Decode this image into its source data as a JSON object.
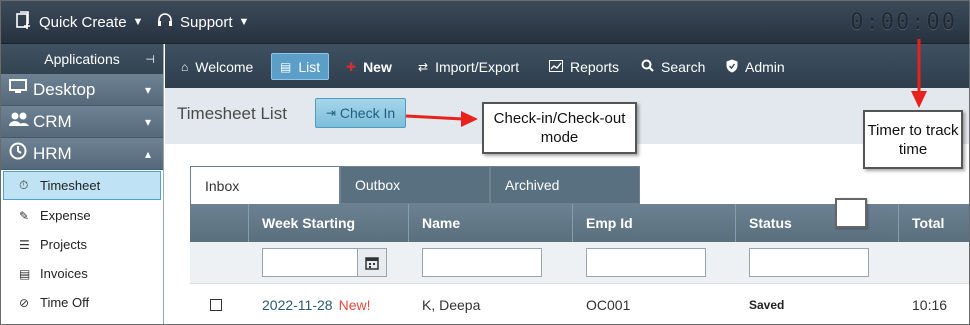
{
  "topbar": {
    "quick_create": "Quick Create",
    "support": "Support",
    "timer": "0:00:00"
  },
  "sidebar": {
    "header": "Applications",
    "modules": [
      {
        "label": "Desktop",
        "icon": "monitor-icon"
      },
      {
        "label": "CRM",
        "icon": "people-icon"
      },
      {
        "label": "HRM",
        "icon": "clock-icon"
      }
    ],
    "items": [
      {
        "label": "Timesheet",
        "icon": "stopwatch-icon"
      },
      {
        "label": "Expense",
        "icon": "money-icon"
      },
      {
        "label": "Projects",
        "icon": "list-icon"
      },
      {
        "label": "Invoices",
        "icon": "invoice-icon"
      },
      {
        "label": "Time Off",
        "icon": "time-off-icon"
      }
    ]
  },
  "nav": {
    "items": [
      {
        "label": "Welcome",
        "icon": "home-icon"
      },
      {
        "label": "List",
        "icon": "list-doc-icon"
      },
      {
        "label": "New",
        "icon": "new-icon"
      },
      {
        "label": "Import/Export",
        "icon": "swap-icon"
      },
      {
        "label": "Reports",
        "icon": "chart-icon"
      },
      {
        "label": "Search",
        "icon": "search-icon"
      },
      {
        "label": "Admin",
        "icon": "shield-icon"
      }
    ],
    "active": "List"
  },
  "content": {
    "title": "Timesheet List",
    "checkin_label": "Check In",
    "tabs": [
      "Inbox",
      "Outbox",
      "Archived"
    ],
    "columns": [
      "Week Starting",
      "Name",
      "Emp Id",
      "Status",
      "Total"
    ],
    "rows": [
      {
        "week": "2022-11-28",
        "new": "New!",
        "name": "K, Deepa",
        "emp_id": "OC001",
        "status": "Saved",
        "total": "10:16"
      }
    ]
  },
  "annotations": {
    "checkin_callout": "Check-in/Check-out mode",
    "timer_callout": "Timer to track time",
    "arrow_color": "#e8211c"
  },
  "colors": {
    "topbar": "#2f3b48",
    "accent": "#5b9fc9",
    "module": "#607486"
  }
}
